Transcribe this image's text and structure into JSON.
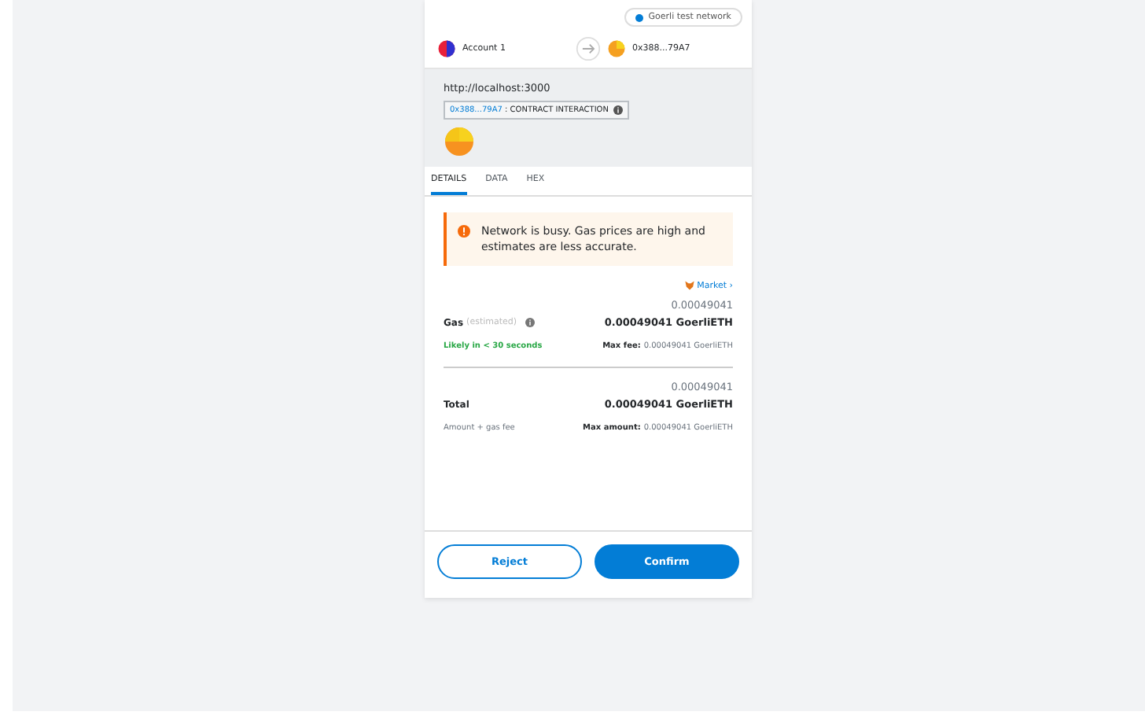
{
  "network": {
    "label": "Goerli test network"
  },
  "accounts": {
    "from": "Account 1",
    "to": "0x388...79A7"
  },
  "origin": "http://localhost:3000",
  "contract": {
    "address": "0x388...79A7",
    "label": ": CONTRACT INTERACTION"
  },
  "tabs": [
    {
      "label": "DETAILS",
      "selected": true
    },
    {
      "label": "DATA",
      "selected": false
    },
    {
      "label": "HEX",
      "selected": false
    }
  ],
  "warning": "Network is busy. Gas prices are high and estimates are less accurate.",
  "market": "Market",
  "market_chevron": "›",
  "gas": {
    "label": "Gas",
    "note": "(estimated)",
    "fiat": "0.00049041",
    "amount": "0.00049041 GoerliETH",
    "speed": "Likely in < 30 seconds",
    "max_label": "Max fee:",
    "max_value": "0.00049041 GoerliETH"
  },
  "total": {
    "label": "Total",
    "fiat": "0.00049041",
    "amount": "0.00049041 GoerliETH",
    "sub": "Amount + gas fee",
    "max_label": "Max amount:",
    "max_value": "0.00049041 GoerliETH"
  },
  "buttons": {
    "reject": "Reject",
    "confirm": "Confirm"
  }
}
